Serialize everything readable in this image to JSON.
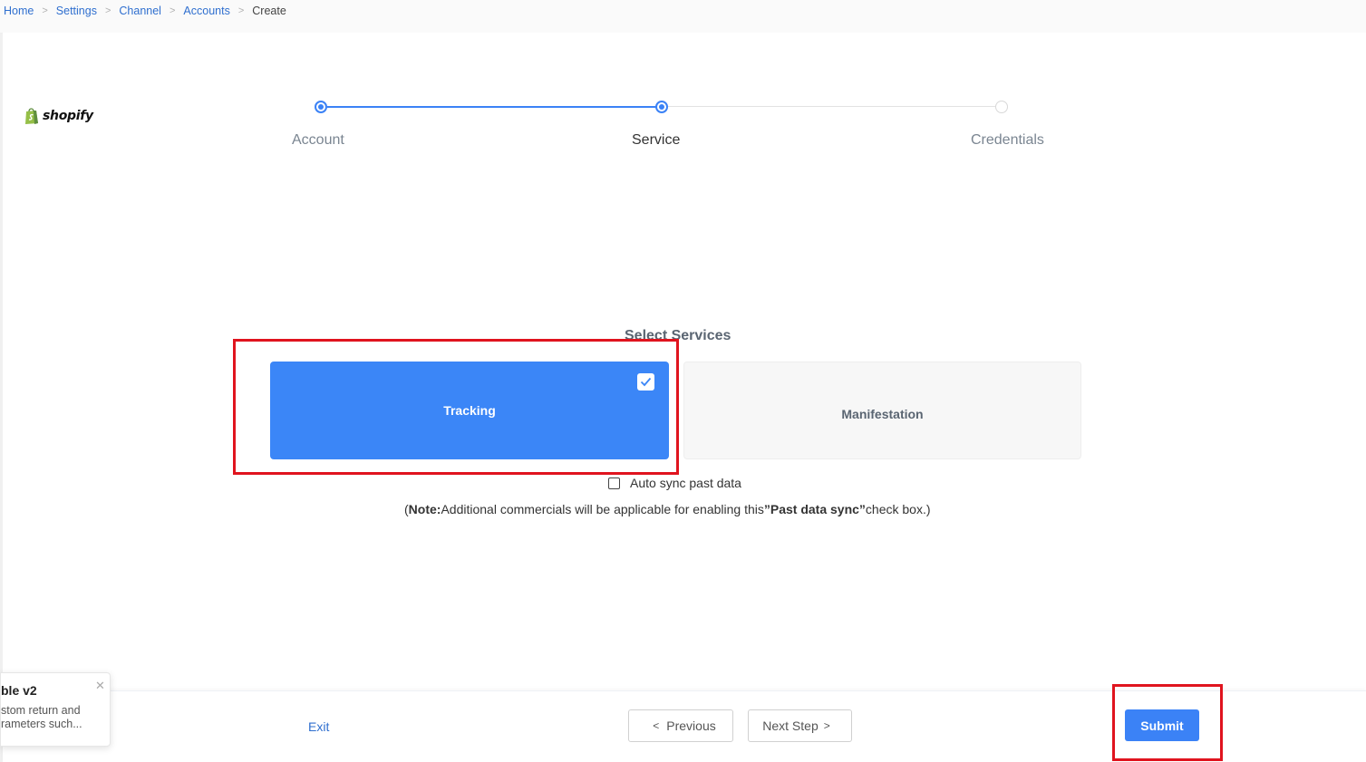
{
  "breadcrumb": {
    "items": [
      "Home",
      "Settings",
      "Channel",
      "Accounts"
    ],
    "current": "Create"
  },
  "brand": {
    "logo_text": "shopify"
  },
  "steps": [
    {
      "label": "Account",
      "status": "done"
    },
    {
      "label": "Service",
      "status": "current"
    },
    {
      "label": "Credentials",
      "status": "pending"
    }
  ],
  "services": {
    "title": "Select Services",
    "tracking": {
      "label": "Tracking",
      "selected": true
    },
    "manifestation": {
      "label": "Manifestation",
      "selected": false
    }
  },
  "autosync": {
    "label": "Auto sync past data",
    "checked": false
  },
  "note": {
    "open": "(",
    "bold1": "Note:",
    "text1": "Additional commercials will be applicable for enabling this",
    "bold2": "”Past data sync”",
    "text2": "check box.)"
  },
  "footer": {
    "exit": "Exit",
    "previous": "Previous",
    "next": "Next Step",
    "submit": "Submit"
  },
  "toast": {
    "title": "ble v2",
    "line1": "stom return and",
    "line2": "rameters such..."
  },
  "colors": {
    "accent": "#3b82f6",
    "highlight": "#e0141e",
    "link": "#2f6fcf"
  }
}
